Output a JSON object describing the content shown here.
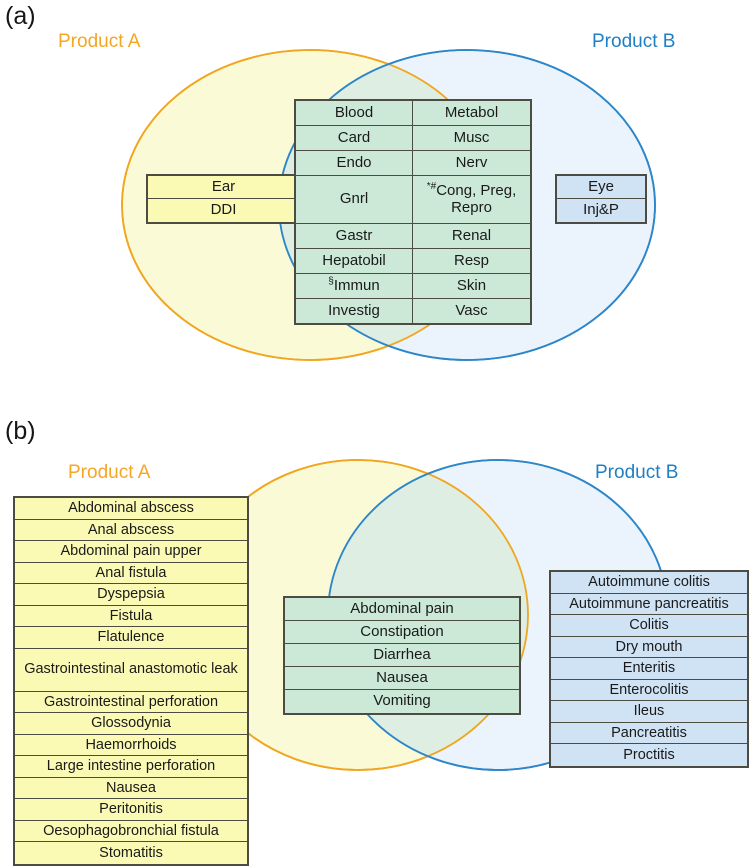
{
  "panels": {
    "a": {
      "letter": "(a)",
      "label_left": "Product A",
      "label_right": "Product B",
      "colors": {
        "product_a": "#F5A623",
        "product_b": "#1F7FC4",
        "fill_a": "#FAFAD7",
        "fill_b": "#E8F2FC",
        "fill_overlap": "#DFEEE2"
      },
      "left_only": [
        "Ear",
        "DDI"
      ],
      "right_only": [
        "Eye",
        "Inj&P"
      ],
      "shared_table": {
        "rows": [
          {
            "left": "Blood",
            "right": "Metabol",
            "tall": false
          },
          {
            "left": "Card",
            "right": "Musc",
            "tall": false
          },
          {
            "left": "Endo",
            "right": "Nerv",
            "tall": false
          },
          {
            "left": "Gnrl",
            "right": "Cong, Preg, Repro",
            "right_superscript": "*#",
            "tall": true
          },
          {
            "left": "Gastr",
            "right": "Renal",
            "tall": false
          },
          {
            "left": "Hepatobil",
            "right": "Resp",
            "tall": false
          },
          {
            "left": "Immun",
            "left_superscript": "§",
            "right": "Skin",
            "tall": false
          },
          {
            "left": "Investig",
            "right": "Vasc",
            "tall": false
          }
        ]
      }
    },
    "b": {
      "letter": "(b)",
      "label_left": "Product A",
      "label_right": "Product B",
      "left_only": [
        "Abdominal abscess",
        "Anal abscess",
        "Abdominal pain upper",
        "Anal fistula",
        "Dyspepsia",
        "Fistula",
        "Flatulence",
        "Gastrointestinal anastomotic leak",
        "Gastrointestinal perforation",
        "Glossodynia",
        "Haemorrhoids",
        "Large intestine perforation",
        "Nausea",
        "Peritonitis",
        "Oesophagobronchial fistula",
        "Stomatitis"
      ],
      "shared": [
        "Abdominal pain",
        "Constipation",
        "Diarrhea",
        "Nausea",
        "Vomiting"
      ],
      "right_only": [
        "Autoimmune colitis",
        "Autoimmune pancreatitis",
        "Colitis",
        "Dry mouth",
        "Enteritis",
        "Enterocolitis",
        "Ileus",
        "Pancreatitis",
        "Proctitis"
      ]
    }
  }
}
